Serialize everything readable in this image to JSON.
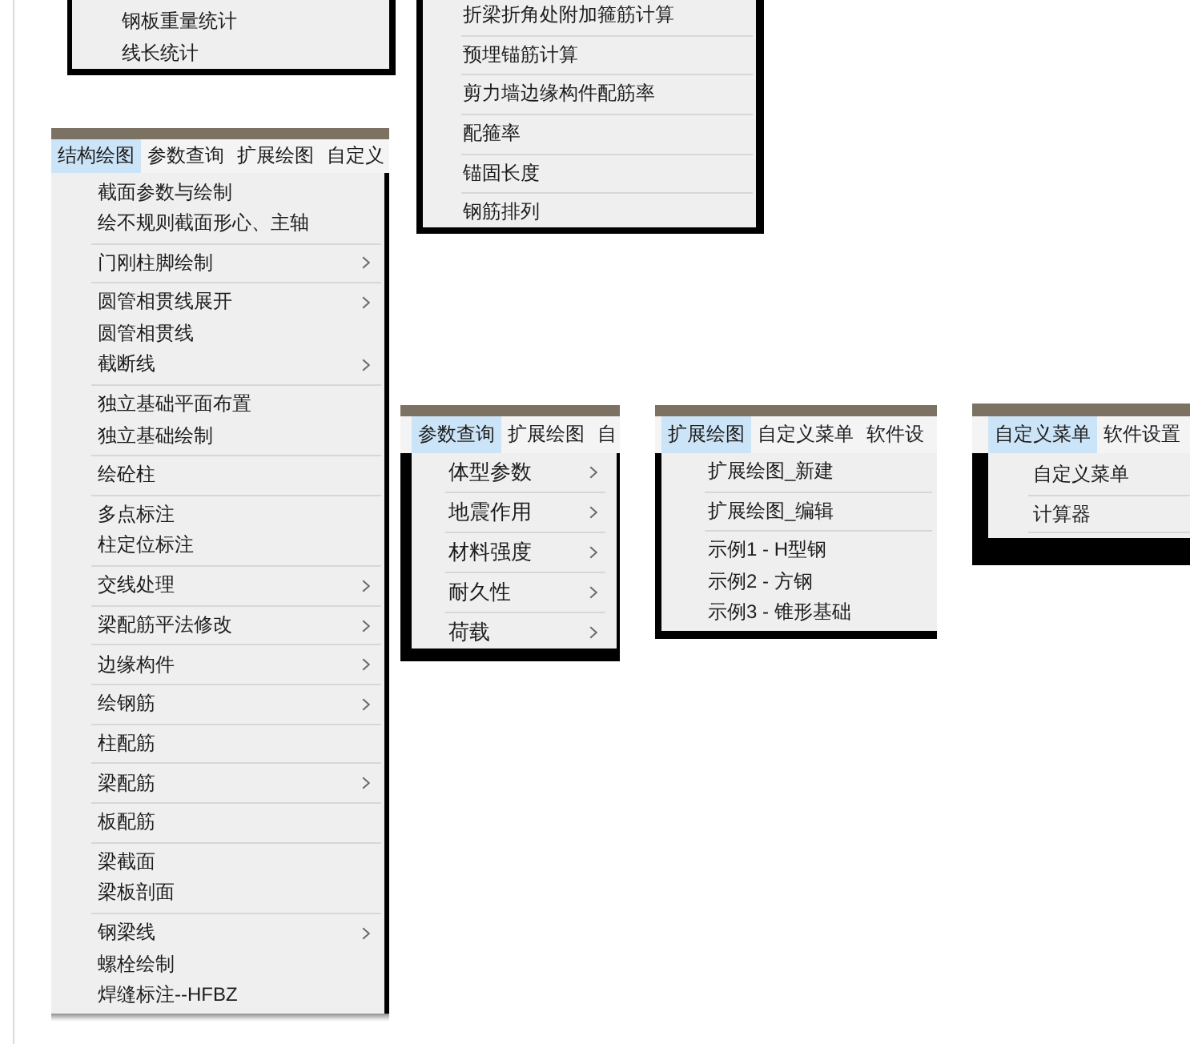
{
  "panels": [
    {
      "kind": "fragment",
      "groups": [
        {
          "items": [
            {
              "label": "钢板重量统计",
              "submenu": false
            },
            {
              "label": "线长统计",
              "submenu": false
            }
          ]
        }
      ]
    },
    {
      "kind": "fragment",
      "groups": [
        {
          "items": [
            {
              "label": "折梁折角处附加箍筋计算",
              "submenu": false
            }
          ]
        },
        {
          "items": [
            {
              "label": "预埋锚筋计算",
              "submenu": false
            }
          ]
        },
        {
          "items": [
            {
              "label": "剪力墙边缘构件配筋率",
              "submenu": false
            }
          ]
        },
        {
          "items": [
            {
              "label": "配箍率",
              "submenu": false
            }
          ]
        },
        {
          "items": [
            {
              "label": "锚固长度",
              "submenu": false
            }
          ]
        },
        {
          "items": [
            {
              "label": "钢筋排列",
              "submenu": false
            }
          ]
        }
      ]
    },
    {
      "kind": "menu",
      "menubar": [
        {
          "label": "结构绘图",
          "selected": true
        },
        {
          "label": "参数查询",
          "selected": false
        },
        {
          "label": "扩展绘图",
          "selected": false
        },
        {
          "label": "自定义",
          "selected": false
        }
      ],
      "groups": [
        {
          "items": [
            {
              "label": "截面参数与绘制",
              "submenu": false
            },
            {
              "label": "绘不规则截面形心、主轴",
              "submenu": false
            }
          ]
        },
        {
          "items": [
            {
              "label": "门刚柱脚绘制",
              "submenu": true
            }
          ]
        },
        {
          "items": [
            {
              "label": "圆管相贯线展开",
              "submenu": true
            },
            {
              "label": "圆管相贯线",
              "submenu": false
            },
            {
              "label": "截断线",
              "submenu": true
            }
          ]
        },
        {
          "items": [
            {
              "label": "独立基础平面布置",
              "submenu": false
            },
            {
              "label": "独立基础绘制",
              "submenu": false
            }
          ]
        },
        {
          "items": [
            {
              "label": "绘砼柱",
              "submenu": false
            }
          ]
        },
        {
          "items": [
            {
              "label": "多点标注",
              "submenu": false
            },
            {
              "label": "柱定位标注",
              "submenu": false
            }
          ]
        },
        {
          "items": [
            {
              "label": "交线处理",
              "submenu": true
            }
          ]
        },
        {
          "items": [
            {
              "label": "梁配筋平法修改",
              "submenu": true
            }
          ]
        },
        {
          "items": [
            {
              "label": "边缘构件",
              "submenu": true
            }
          ]
        },
        {
          "items": [
            {
              "label": "绘钢筋",
              "submenu": true
            }
          ]
        },
        {
          "items": [
            {
              "label": "柱配筋",
              "submenu": false
            }
          ]
        },
        {
          "items": [
            {
              "label": "梁配筋",
              "submenu": true
            }
          ]
        },
        {
          "items": [
            {
              "label": "板配筋",
              "submenu": false
            }
          ]
        },
        {
          "items": [
            {
              "label": "梁截面",
              "submenu": false
            },
            {
              "label": "梁板剖面",
              "submenu": false
            }
          ]
        },
        {
          "items": [
            {
              "label": "钢梁线",
              "submenu": true
            },
            {
              "label": "螺栓绘制",
              "submenu": false
            },
            {
              "label": "焊缝标注--HFBZ",
              "submenu": false
            }
          ]
        }
      ]
    },
    {
      "kind": "menu",
      "menubar": [
        {
          "label": "参数查询",
          "selected": true
        },
        {
          "label": "扩展绘图",
          "selected": false
        },
        {
          "label": "自",
          "selected": false
        }
      ],
      "groups": [
        {
          "items": [
            {
              "label": "体型参数",
              "submenu": true
            }
          ]
        },
        {
          "items": [
            {
              "label": "地震作用",
              "submenu": true
            }
          ]
        },
        {
          "items": [
            {
              "label": "材料强度",
              "submenu": true
            }
          ]
        },
        {
          "items": [
            {
              "label": "耐久性",
              "submenu": true
            }
          ]
        },
        {
          "items": [
            {
              "label": "荷载",
              "submenu": true
            }
          ]
        }
      ]
    },
    {
      "kind": "menu",
      "menubar": [
        {
          "label": "扩展绘图",
          "selected": true
        },
        {
          "label": "自定义菜单",
          "selected": false
        },
        {
          "label": "软件设",
          "selected": false
        }
      ],
      "groups": [
        {
          "items": [
            {
              "label": "扩展绘图_新建",
              "submenu": false
            }
          ]
        },
        {
          "items": [
            {
              "label": "扩展绘图_编辑",
              "submenu": false
            }
          ]
        },
        {
          "items": [
            {
              "label": "示例1 - H型钢",
              "submenu": false
            },
            {
              "label": "示例2 - 方钢",
              "submenu": false
            },
            {
              "label": "示例3 - 锥形基础",
              "submenu": false
            }
          ]
        }
      ]
    },
    {
      "kind": "menu",
      "menubar": [
        {
          "label": "自定义菜单",
          "selected": true
        },
        {
          "label": "软件设置",
          "selected": false
        }
      ],
      "groups": [
        {
          "items": [
            {
              "label": "自定义菜单",
              "submenu": false
            }
          ]
        },
        {
          "items": [
            {
              "label": "计算器",
              "submenu": false
            }
          ]
        }
      ]
    }
  ]
}
